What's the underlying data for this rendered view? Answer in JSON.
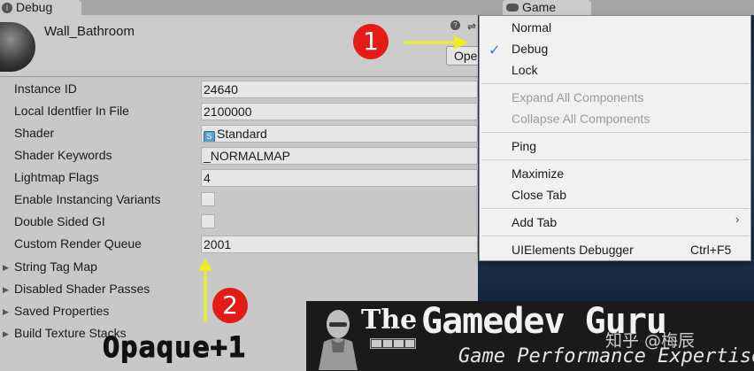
{
  "tabs": {
    "debug_label": "Debug",
    "game_label": "Game"
  },
  "header": {
    "asset_name": "Wall_Bathroom",
    "open_button": "Ope"
  },
  "properties": [
    {
      "label": "Instance ID",
      "value": "24640",
      "type": "field"
    },
    {
      "label": "Local Identfier In File",
      "value": "2100000",
      "type": "field"
    },
    {
      "label": "Shader",
      "value": "Standard",
      "type": "shader"
    },
    {
      "label": "Shader Keywords",
      "value": "_NORMALMAP",
      "type": "field"
    },
    {
      "label": "Lightmap Flags",
      "value": "4",
      "type": "field"
    },
    {
      "label": "Enable Instancing Variants",
      "checked": false,
      "type": "check"
    },
    {
      "label": "Double Sided GI",
      "checked": false,
      "type": "check"
    },
    {
      "label": "Custom Render Queue",
      "value": "2001",
      "type": "field"
    }
  ],
  "foldouts": [
    {
      "label": "String Tag Map"
    },
    {
      "label": "Disabled Shader Passes"
    },
    {
      "label": "Saved Properties"
    },
    {
      "label": "Build Texture Stacks"
    }
  ],
  "menu": {
    "items": [
      {
        "label": "Normal",
        "checked": false,
        "disabled": false
      },
      {
        "label": "Debug",
        "checked": true,
        "disabled": false
      },
      {
        "label": "Lock",
        "checked": false,
        "disabled": false
      },
      {
        "label": "Expand All Components",
        "checked": false,
        "disabled": true
      },
      {
        "label": "Collapse All Components",
        "checked": false,
        "disabled": true
      },
      {
        "label": "Ping",
        "checked": false,
        "disabled": false
      },
      {
        "label": "Maximize",
        "checked": false,
        "disabled": false
      },
      {
        "label": "Close Tab",
        "checked": false,
        "disabled": false
      },
      {
        "label": "Add Tab",
        "checked": false,
        "disabled": false,
        "submenu": true
      },
      {
        "label": "UIElements Debugger",
        "checked": false,
        "disabled": false,
        "shortcut": "Ctrl+F5"
      }
    ]
  },
  "annotations": {
    "badge1": "1",
    "badge2": "2",
    "opaque_text": "Opaque+1",
    "arrow_color": "#e8f020",
    "badge_color": "#e41b17"
  },
  "banner": {
    "the": "The",
    "title": "Gamedev Guru",
    "subtitle": "Game Performance Expertise",
    "watermark": "知乎 @梅辰"
  },
  "colors": {
    "panel_bg": "#c8c8c8",
    "menu_bg": "#f1f1f1",
    "check_blue": "#3a7bd5"
  }
}
